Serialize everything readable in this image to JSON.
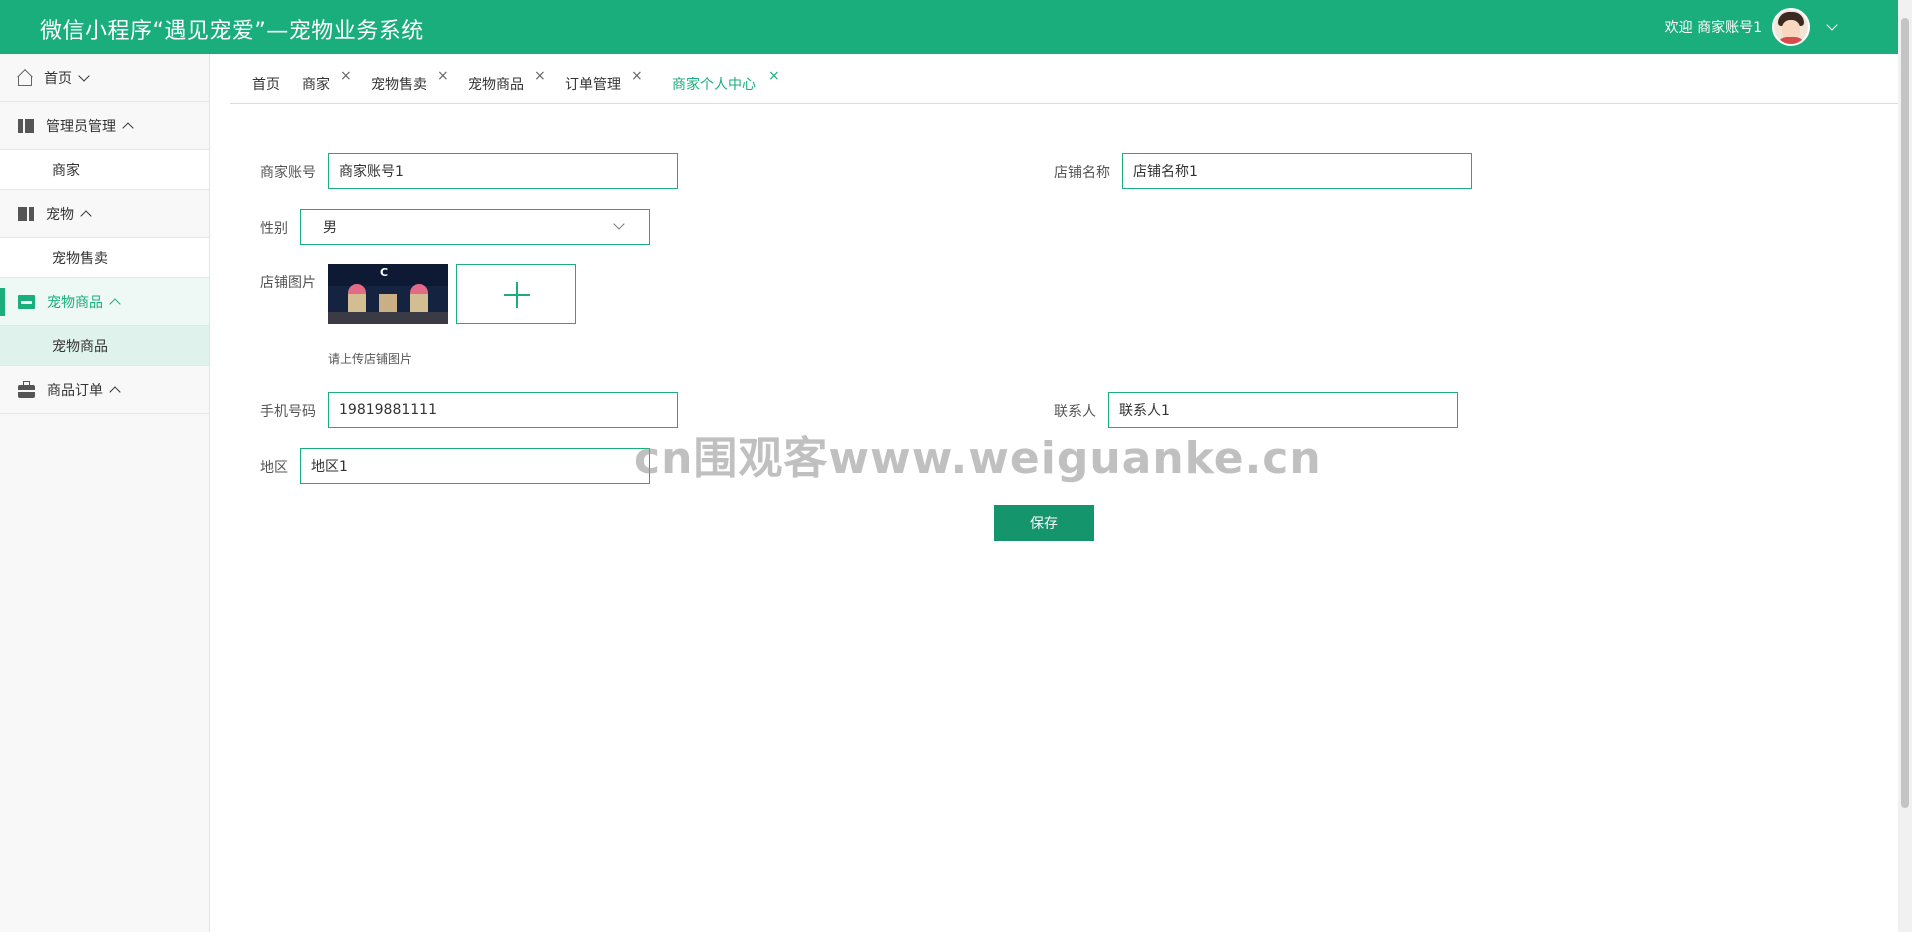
{
  "header": {
    "title": "微信小程序“遇见宠爱”—宠物业务系统",
    "welcome": "欢迎 商家账号1"
  },
  "sidebar": {
    "items": [
      {
        "label": "首页",
        "icon": "home-icon"
      },
      {
        "label": "管理员管理",
        "icon": "book-icon",
        "children": [
          "商家"
        ]
      },
      {
        "label": "宠物",
        "icon": "book-icon",
        "children": [
          "宠物售卖"
        ]
      },
      {
        "label": "宠物商品",
        "icon": "shop-icon",
        "children": [
          "宠物商品"
        ]
      },
      {
        "label": "商品订单",
        "icon": "bag-icon"
      }
    ]
  },
  "tabs": [
    {
      "label": "首页",
      "closable": false
    },
    {
      "label": "商家",
      "closable": true
    },
    {
      "label": "宠物售卖",
      "closable": true
    },
    {
      "label": "宠物商品",
      "closable": true
    },
    {
      "label": "订单管理",
      "closable": true
    },
    {
      "label": "商家个人中心",
      "closable": true,
      "active": true
    }
  ],
  "close_glyph": "×",
  "form": {
    "account_label": "商家账号",
    "account_value": "商家账号1",
    "shop_name_label": "店铺名称",
    "shop_name_value": "店铺名称1",
    "gender_label": "性别",
    "gender_value": "男",
    "shop_image_label": "店铺图片",
    "shop_image_sign": "C",
    "upload_hint": "请上传店铺图片",
    "phone_label": "手机号码",
    "phone_value": "19819881111",
    "contact_label": "联系人",
    "contact_value": "联系人1",
    "region_label": "地区",
    "region_value": "地区1",
    "save_label": "保存"
  },
  "watermark": "cn围观客www.weiguanke.cn",
  "colors": {
    "accent": "#1aae7d",
    "button": "#14956b"
  }
}
